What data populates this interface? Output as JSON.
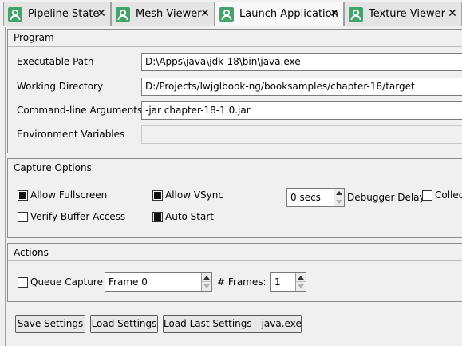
{
  "tabs": [
    {
      "label": "Pipeline State",
      "close": "✕",
      "active": false
    },
    {
      "label": "Mesh Viewer",
      "close": "✕",
      "active": false
    },
    {
      "label": "Launch Application",
      "close": "✕",
      "active": true
    },
    {
      "label": "Texture Viewer",
      "close": "✕",
      "active": false
    }
  ],
  "program": {
    "title": "Program",
    "exe_label": "Executable Path",
    "exe_value": "D:\\Apps\\java\\jdk-18\\bin\\java.exe",
    "workdir_label": "Working Directory",
    "workdir_value": "D:/Projects/lwjglbook-ng/booksamples/chapter-18/target",
    "args_label": "Command-line Arguments",
    "args_value": "-jar chapter-18-1.0.jar",
    "env_label": "Environment Variables",
    "env_value": ""
  },
  "capture": {
    "title": "Capture Options",
    "allow_fullscreen": {
      "label": "Allow Fullscreen",
      "checked": true
    },
    "allow_vsync": {
      "label": "Allow VSync",
      "checked": true
    },
    "verify_buffer": {
      "label": "Verify Buffer Access",
      "checked": false
    },
    "auto_start": {
      "label": "Auto Start",
      "checked": true
    },
    "debugger_delay_value": "0 secs",
    "debugger_delay_label": "Debugger Delay",
    "collect_label": "Collec",
    "collect_checked": false
  },
  "actions": {
    "title": "Actions",
    "queue_capture": {
      "label": "Queue Capture",
      "checked": false
    },
    "frame_value": "Frame 0",
    "frames_label": "# Frames:",
    "frames_value": "1"
  },
  "buttons": {
    "save": "Save Settings",
    "load": "Load Settings",
    "load_last": "Load Last Settings - java.exe"
  },
  "colors": {
    "tab_icon": "#43a36b"
  }
}
